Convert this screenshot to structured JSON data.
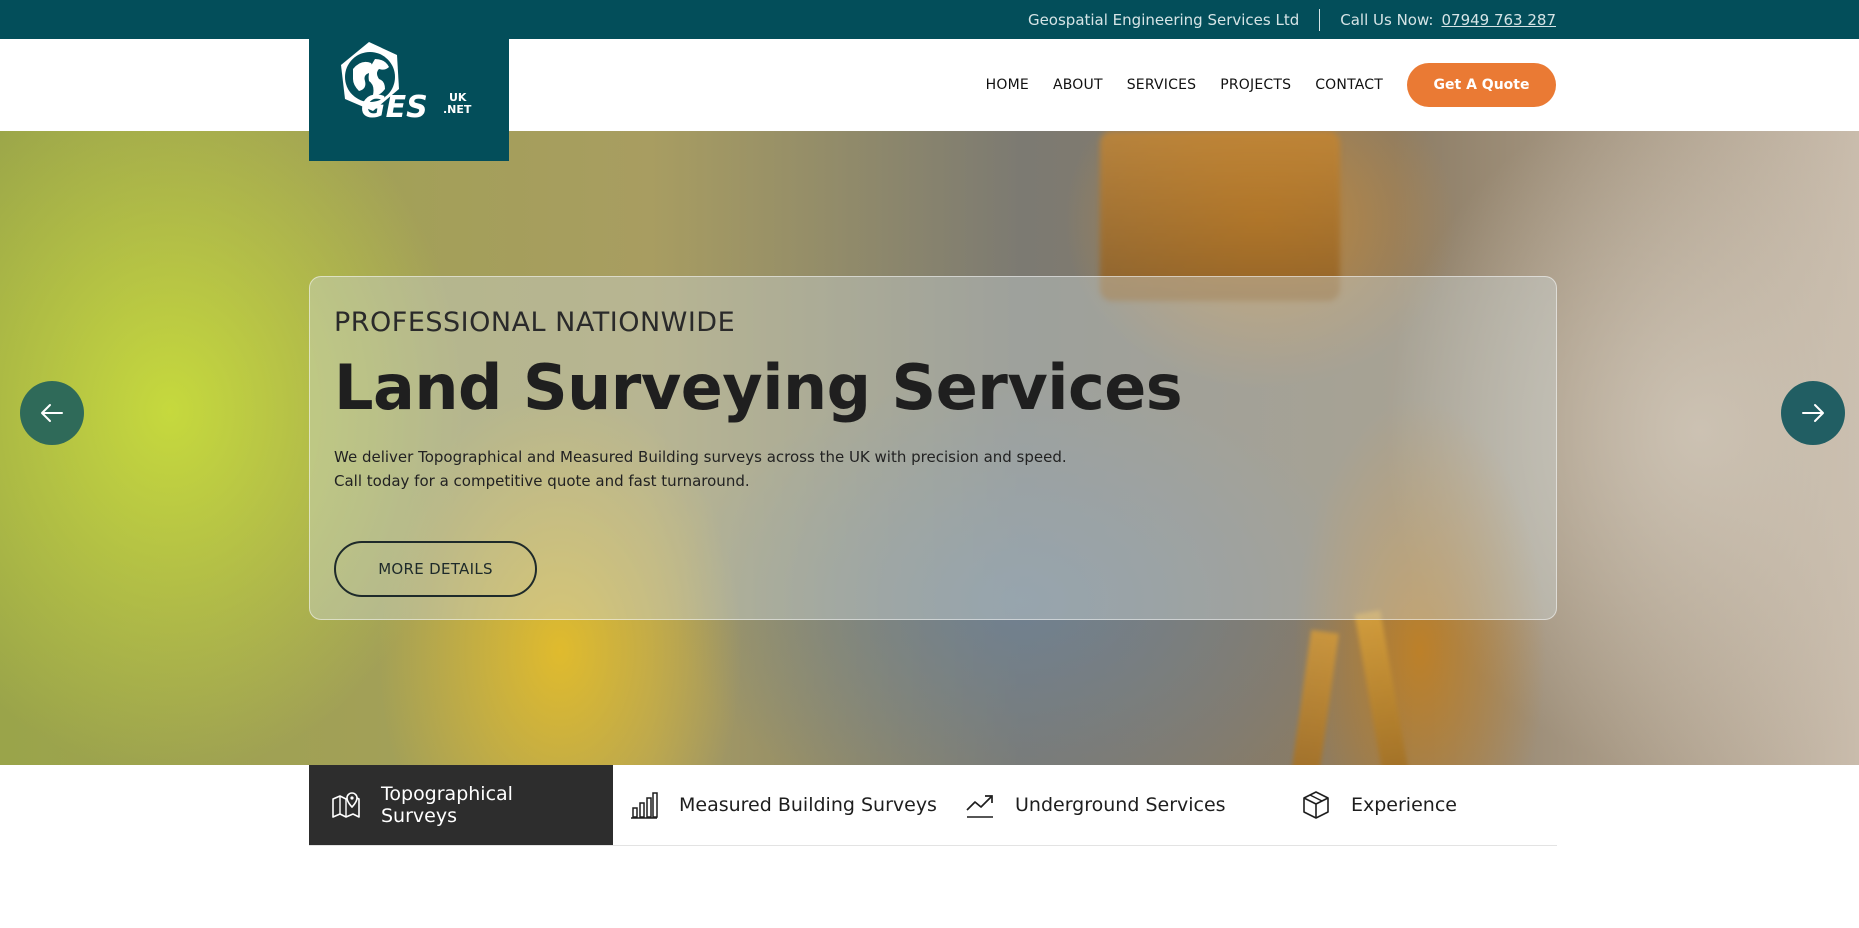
{
  "topbar": {
    "company": "Geospatial Engineering Services Ltd",
    "call_label": "Call Us Now:",
    "phone": "07949 763 287"
  },
  "logo": {
    "text": "GES",
    "suffix_top": "UK",
    "suffix_bottom": ".NET",
    "icon": "globe-hexagon-icon"
  },
  "nav": {
    "items": [
      "HOME",
      "ABOUT",
      "SERVICES",
      "PROJECTS",
      "CONTACT"
    ],
    "cta": "Get A Quote"
  },
  "hero": {
    "subtitle": "PROFESSIONAL NATIONWIDE",
    "title": "Land Surveying Services",
    "description_line1": "We deliver Topographical and Measured Building surveys across the UK with precision and speed.",
    "description_line2": "Call today for a competitive quote and fast turnaround.",
    "button": "MORE DETAILS",
    "prev_icon": "arrow-left-icon",
    "next_icon": "arrow-right-icon"
  },
  "tabs": [
    {
      "label": "Topographical Surveys",
      "icon": "map-pin-icon",
      "active": true
    },
    {
      "label": "Measured Building Surveys",
      "icon": "bar-chart-icon",
      "active": false
    },
    {
      "label": "Underground Services",
      "icon": "trend-up-icon",
      "active": false
    },
    {
      "label": "Experience",
      "icon": "cube-icon",
      "active": false
    }
  ],
  "colors": {
    "brand_teal": "#034e5a",
    "accent_orange": "#ea7a34",
    "active_tab": "#2d2d2d"
  }
}
